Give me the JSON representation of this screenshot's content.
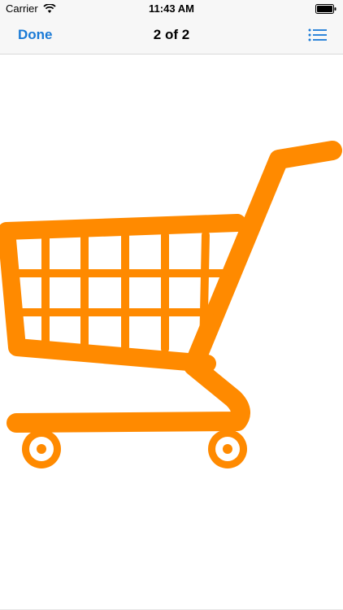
{
  "status_bar": {
    "carrier": "Carrier",
    "time": "11:43 AM"
  },
  "nav": {
    "done_label": "Done",
    "title": "2 of 2"
  },
  "icons": {
    "wifi": "wifi-icon",
    "battery": "battery-icon",
    "list": "list-icon",
    "image": "shopping-cart-image"
  },
  "colors": {
    "accent": "#1a7ad6",
    "cart": "#ff8a00"
  }
}
